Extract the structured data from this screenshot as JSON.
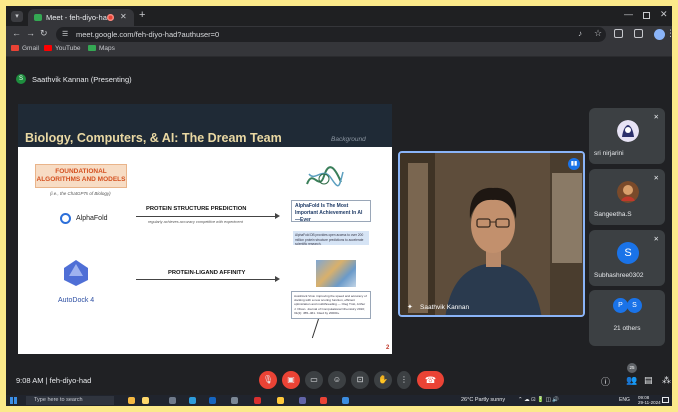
{
  "browser": {
    "tab_title": "Meet - feh-diyo-had",
    "url": "meet.google.com/feh-diyo-had?authuser=0",
    "bookmarks": [
      "Gmail",
      "YouTube",
      "Maps"
    ]
  },
  "meet": {
    "presenter_banner": "Saathvik Kannan (Presenting)",
    "presenter_initial": "S",
    "time_and_code": "9:08 AM  |  feh-diyo-had",
    "main_video_name": "Saathvik Kannan",
    "participant_count_badge": "25",
    "participants": [
      {
        "name": "sri nirjarini"
      },
      {
        "name": "Sangeetha.S"
      },
      {
        "name": "Subhashree0302",
        "initial": "S"
      }
    ],
    "others": {
      "label": "21 others",
      "initials": [
        "P",
        "S"
      ]
    }
  },
  "slide": {
    "title": "Biology, Computers, & AI: The Dream Team",
    "section": "Background",
    "algo_heading": "FOUNDATIONAL ALGORITHMS AND MODELS",
    "algo_sub": "(i.e., the ChatGPTs of Biology)",
    "alphafold": "AlphaFold",
    "psp_label": "PROTEIN STRUCTURE PREDICTION",
    "psp_sub": "regularly achieves accuracy competitive with experiment",
    "af_box": "AlphaFold Is The Most Important Achievement In AI—Ever",
    "af_note": "AlphaFold DB provides open access to over 200 million protein structure predictions to accelerate scientific research.",
    "autodock": "AutoDock 4",
    "pla_label": "PROTEIN-LIGAND AFFINITY",
    "ligand_box": "AutoDock Vina: improving the speed and accuracy of docking with a new scoring function, efficient optimization and multithreading — Oleg Trott, Arthur J. Olson. Journal of Computational Chemistry 2010; 31(2): 455–461. Cited by 20000+",
    "page": "2"
  },
  "taskbar": {
    "search_placeholder": "Type here to search",
    "weather": "26°C  Partly sunny",
    "lang": "ENG",
    "time": "09:08",
    "date": "29-11-2024"
  },
  "colors": {
    "meet_bg": "#202124",
    "accent_blue": "#8ab4f8",
    "end_call_red": "#ea4335",
    "slide_title": "#e9d8a3"
  }
}
